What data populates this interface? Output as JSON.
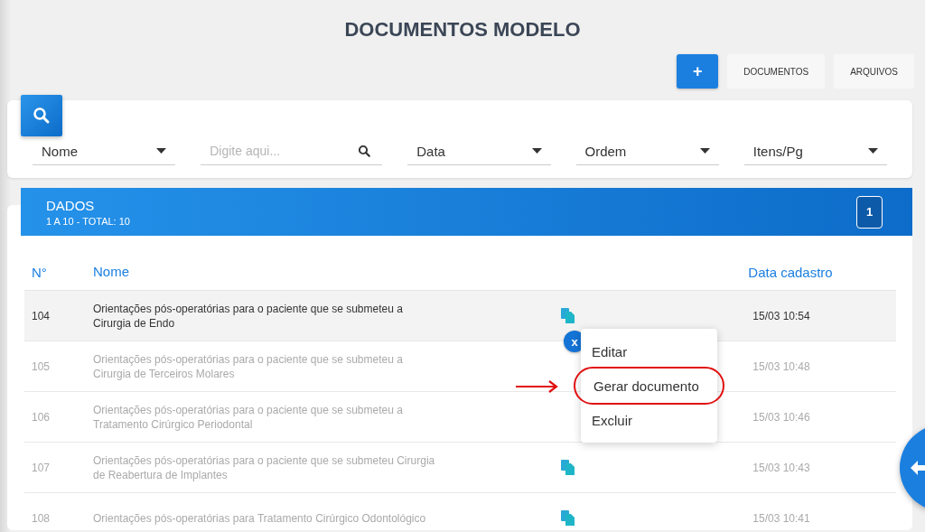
{
  "title": "DOCUMENTOS MODELO",
  "actions": [
    {
      "kind": "add",
      "label": "+"
    },
    {
      "kind": "plain",
      "label": "DOCUMENTOS"
    },
    {
      "kind": "plain",
      "label": "ARQUIVOS"
    }
  ],
  "filters": [
    {
      "kind": "select",
      "label": "Nome"
    },
    {
      "kind": "search",
      "placeholder": "Digite aqui..."
    },
    {
      "kind": "select",
      "label": "Data"
    },
    {
      "kind": "select",
      "label": "Ordem"
    },
    {
      "kind": "select",
      "label": "Itens/Pg"
    }
  ],
  "data_panel": {
    "title": "DADOS",
    "subtitle": "1 A 10 - TOTAL: 10",
    "page": "1"
  },
  "table": {
    "columns": [
      "N°",
      "Nome",
      "Data cadastro"
    ],
    "rows": [
      {
        "number": "104",
        "name": "Orientações pós-operatórias para o paciente que se submeteu a Cirurgia de Endo",
        "date": "15/03 10:54",
        "selected": true,
        "blurred": false,
        "doc_icon": true
      },
      {
        "number": "105",
        "name": "Orientações pós-operatórias para o paciente que se submeteu a Cirurgia de Terceiros Molares",
        "date": "15/03 10:48",
        "selected": false,
        "blurred": true,
        "doc_icon": false
      },
      {
        "number": "106",
        "name": "Orientações pós-operatórias para o paciente que se submeteu a Tratamento Cirúrgico Periodontal",
        "date": "15/03 10:46",
        "selected": false,
        "blurred": true,
        "doc_icon": false
      },
      {
        "number": "107",
        "name": "Orientações pós-operatórias para o paciente que se submeteu Cirurgia de Reabertura de Implantes",
        "date": "15/03 10:43",
        "selected": false,
        "blurred": true,
        "doc_icon": true
      },
      {
        "number": "108",
        "name": "Orientações pós-operatórias para Tratamento Cirúrgico Odontológico",
        "date": "15/03 10:41",
        "selected": false,
        "blurred": true,
        "doc_icon": true
      }
    ]
  },
  "context_menu": {
    "close": "x",
    "items": [
      {
        "label": "Editar",
        "highlighted": false
      },
      {
        "label": "Gerar documento",
        "highlighted": true
      },
      {
        "label": "Excluir",
        "highlighted": false
      }
    ]
  }
}
